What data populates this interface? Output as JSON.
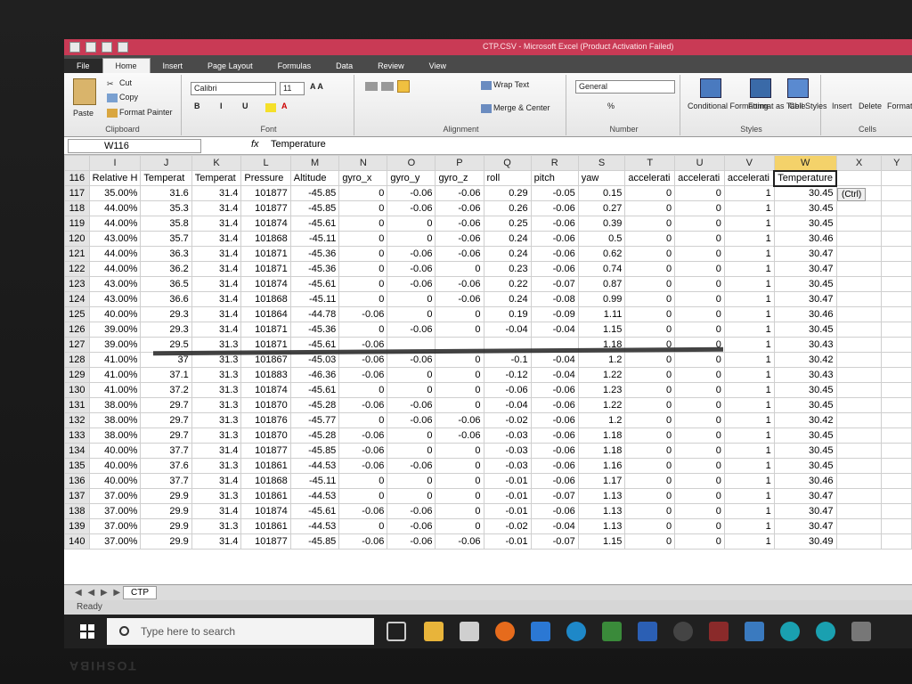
{
  "window": {
    "title": "CTP.CSV - Microsoft Excel (Product Activation Failed)"
  },
  "tabs": [
    "File",
    "Home",
    "Insert",
    "Page Layout",
    "Formulas",
    "Data",
    "Review",
    "View"
  ],
  "ribbon": {
    "paste": "Paste",
    "cut": "Cut",
    "copy": "Copy",
    "format_painter": "Format Painter",
    "clipboard": "Clipboard",
    "font_name": "Calibri",
    "font_size": "11",
    "font": "Font",
    "wrap_text": "Wrap Text",
    "merge_center": "Merge & Center",
    "alignment": "Alignment",
    "number_format": "General",
    "number": "Number",
    "conditional_formatting": "Conditional Formatting",
    "format_as_table": "Format as Table",
    "cell_styles": "Cell Styles",
    "styles": "Styles",
    "insert": "Insert",
    "delete": "Delete",
    "format": "Format",
    "cells": "Cells",
    "percent": "%"
  },
  "formula_bar": {
    "name_box": "W116",
    "fx": "fx",
    "value": "Temperature"
  },
  "columns": [
    "I",
    "J",
    "K",
    "L",
    "M",
    "N",
    "O",
    "P",
    "Q",
    "R",
    "S",
    "T",
    "U",
    "V",
    "W",
    "X",
    "Y"
  ],
  "header_row": {
    "row": "116",
    "cells": [
      "Relative H",
      "Temperat",
      "Temperat",
      "Pressure",
      "Altitude",
      "gyro_x",
      "gyro_y",
      "gyro_z",
      "roll",
      "pitch",
      "yaw",
      "accelerati",
      "accelerati",
      "accelerati",
      "Temperature",
      "",
      ""
    ]
  },
  "rows": [
    {
      "n": "117",
      "c": [
        "35.00%",
        "31.6",
        "31.4",
        "101877",
        "-45.85",
        "0",
        "-0.06",
        "-0.06",
        "0.29",
        "-0.05",
        "0.15",
        "0",
        "0",
        "1",
        "30.45",
        "",
        ""
      ]
    },
    {
      "n": "118",
      "c": [
        "44.00%",
        "35.3",
        "31.4",
        "101877",
        "-45.85",
        "0",
        "-0.06",
        "-0.06",
        "0.26",
        "-0.06",
        "0.27",
        "0",
        "0",
        "1",
        "30.45",
        "",
        ""
      ]
    },
    {
      "n": "119",
      "c": [
        "44.00%",
        "35.8",
        "31.4",
        "101874",
        "-45.61",
        "0",
        "0",
        "-0.06",
        "0.25",
        "-0.06",
        "0.39",
        "0",
        "0",
        "1",
        "30.45",
        "",
        ""
      ]
    },
    {
      "n": "120",
      "c": [
        "43.00%",
        "35.7",
        "31.4",
        "101868",
        "-45.11",
        "0",
        "0",
        "-0.06",
        "0.24",
        "-0.06",
        "0.5",
        "0",
        "0",
        "1",
        "30.46",
        "",
        ""
      ]
    },
    {
      "n": "121",
      "c": [
        "44.00%",
        "36.3",
        "31.4",
        "101871",
        "-45.36",
        "0",
        "-0.06",
        "-0.06",
        "0.24",
        "-0.06",
        "0.62",
        "0",
        "0",
        "1",
        "30.47",
        "",
        ""
      ]
    },
    {
      "n": "122",
      "c": [
        "44.00%",
        "36.2",
        "31.4",
        "101871",
        "-45.36",
        "0",
        "-0.06",
        "0",
        "0.23",
        "-0.06",
        "0.74",
        "0",
        "0",
        "1",
        "30.47",
        "",
        ""
      ]
    },
    {
      "n": "123",
      "c": [
        "43.00%",
        "36.5",
        "31.4",
        "101874",
        "-45.61",
        "0",
        "-0.06",
        "-0.06",
        "0.22",
        "-0.07",
        "0.87",
        "0",
        "0",
        "1",
        "30.45",
        "",
        ""
      ]
    },
    {
      "n": "124",
      "c": [
        "43.00%",
        "36.6",
        "31.4",
        "101868",
        "-45.11",
        "0",
        "0",
        "-0.06",
        "0.24",
        "-0.08",
        "0.99",
        "0",
        "0",
        "1",
        "30.47",
        "",
        ""
      ]
    },
    {
      "n": "125",
      "c": [
        "40.00%",
        "29.3",
        "31.4",
        "101864",
        "-44.78",
        "-0.06",
        "0",
        "0",
        "0.19",
        "-0.09",
        "1.11",
        "0",
        "0",
        "1",
        "30.46",
        "",
        ""
      ]
    },
    {
      "n": "126",
      "c": [
        "39.00%",
        "29.3",
        "31.4",
        "101871",
        "-45.36",
        "0",
        "-0.06",
        "0",
        "-0.04",
        "-0.04",
        "1.15",
        "0",
        "0",
        "1",
        "30.45",
        "",
        ""
      ]
    },
    {
      "n": "127",
      "c": [
        "39.00%",
        "29.5",
        "31.3",
        "101871",
        "-45.61",
        "-0.06",
        "",
        "",
        "",
        "",
        "1.18",
        "0",
        "0",
        "1",
        "30.43",
        "",
        ""
      ]
    },
    {
      "n": "128",
      "c": [
        "41.00%",
        "37",
        "31.3",
        "101867",
        "-45.03",
        "-0.06",
        "-0.06",
        "0",
        "-0.1",
        "-0.04",
        "1.2",
        "0",
        "0",
        "1",
        "30.42",
        "",
        ""
      ]
    },
    {
      "n": "129",
      "c": [
        "41.00%",
        "37.1",
        "31.3",
        "101883",
        "-46.36",
        "-0.06",
        "0",
        "0",
        "-0.12",
        "-0.04",
        "1.22",
        "0",
        "0",
        "1",
        "30.43",
        "",
        ""
      ]
    },
    {
      "n": "130",
      "c": [
        "41.00%",
        "37.2",
        "31.3",
        "101874",
        "-45.61",
        "0",
        "0",
        "0",
        "-0.06",
        "-0.06",
        "1.23",
        "0",
        "0",
        "1",
        "30.45",
        "",
        ""
      ]
    },
    {
      "n": "131",
      "c": [
        "38.00%",
        "29.7",
        "31.3",
        "101870",
        "-45.28",
        "-0.06",
        "-0.06",
        "0",
        "-0.04",
        "-0.06",
        "1.22",
        "0",
        "0",
        "1",
        "30.45",
        "",
        ""
      ]
    },
    {
      "n": "132",
      "c": [
        "38.00%",
        "29.7",
        "31.3",
        "101876",
        "-45.77",
        "0",
        "-0.06",
        "-0.06",
        "-0.02",
        "-0.06",
        "1.2",
        "0",
        "0",
        "1",
        "30.42",
        "",
        ""
      ]
    },
    {
      "n": "133",
      "c": [
        "38.00%",
        "29.7",
        "31.3",
        "101870",
        "-45.28",
        "-0.06",
        "0",
        "-0.06",
        "-0.03",
        "-0.06",
        "1.18",
        "0",
        "0",
        "1",
        "30.45",
        "",
        ""
      ]
    },
    {
      "n": "134",
      "c": [
        "40.00%",
        "37.7",
        "31.4",
        "101877",
        "-45.85",
        "-0.06",
        "0",
        "0",
        "-0.03",
        "-0.06",
        "1.18",
        "0",
        "0",
        "1",
        "30.45",
        "",
        ""
      ]
    },
    {
      "n": "135",
      "c": [
        "40.00%",
        "37.6",
        "31.3",
        "101861",
        "-44.53",
        "-0.06",
        "-0.06",
        "0",
        "-0.03",
        "-0.06",
        "1.16",
        "0",
        "0",
        "1",
        "30.45",
        "",
        ""
      ]
    },
    {
      "n": "136",
      "c": [
        "40.00%",
        "37.7",
        "31.4",
        "101868",
        "-45.11",
        "0",
        "0",
        "0",
        "-0.01",
        "-0.06",
        "1.17",
        "0",
        "0",
        "1",
        "30.46",
        "",
        ""
      ]
    },
    {
      "n": "137",
      "c": [
        "37.00%",
        "29.9",
        "31.3",
        "101861",
        "-44.53",
        "0",
        "0",
        "0",
        "-0.01",
        "-0.07",
        "1.13",
        "0",
        "0",
        "1",
        "30.47",
        "",
        ""
      ]
    },
    {
      "n": "138",
      "c": [
        "37.00%",
        "29.9",
        "31.4",
        "101874",
        "-45.61",
        "-0.06",
        "-0.06",
        "0",
        "-0.01",
        "-0.06",
        "1.13",
        "0",
        "0",
        "1",
        "30.47",
        "",
        ""
      ]
    },
    {
      "n": "139",
      "c": [
        "37.00%",
        "29.9",
        "31.3",
        "101861",
        "-44.53",
        "0",
        "-0.06",
        "0",
        "-0.02",
        "-0.04",
        "1.13",
        "0",
        "0",
        "1",
        "30.47",
        "",
        ""
      ]
    },
    {
      "n": "140",
      "c": [
        "37.00%",
        "29.9",
        "31.4",
        "101877",
        "-45.85",
        "-0.06",
        "-0.06",
        "-0.06",
        "-0.01",
        "-0.07",
        "1.15",
        "0",
        "0",
        "1",
        "30.49",
        "",
        ""
      ]
    }
  ],
  "paste_options": "(Ctrl)",
  "sheet": {
    "nav": "◀ ◀ ▶ ▶",
    "tab": "CTP"
  },
  "status": "Ready",
  "taskbar": {
    "search_placeholder": "Type here to search"
  },
  "device_brand": "TOSHIBA",
  "colors": {
    "title_bar": "#c93a55",
    "selected_header": "#f4d26a",
    "taskbar": "#202020"
  }
}
